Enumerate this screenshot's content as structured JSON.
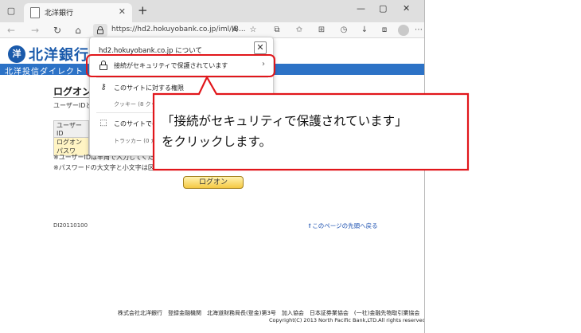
{
  "browser": {
    "tab_title": "北洋銀行",
    "url": "https://hd2.hokuyobank.co.jp/iml/IB...",
    "toolbar_icons": [
      "read-aloud-icon",
      "favorite-star-icon",
      "split-screen-icon",
      "favorites-icon",
      "collections-icon",
      "history-icon",
      "downloads-icon",
      "profile-icon",
      "more-icon"
    ]
  },
  "page": {
    "logo_text": "北洋銀行",
    "subbar_text": "北洋投信ダイレクト",
    "title": "ログオン",
    "intro": "ユーザーIDとロ",
    "form": {
      "user_id_label": "ユーザーID",
      "password_label": "ログオンパスワ"
    },
    "notes": [
      "※ユーザーIDは半角で入力してください。",
      "※パスワードの大文字と小文字は区別さ"
    ],
    "login_button": "ログオン",
    "page_id": "DI20110100",
    "top_link": "このページの先頭へ戻る",
    "footer_line1": "株式会社北洋銀行　登録金融機関　北海道財務局長(登金)第3号　加入協会　日本証券業協会　(一社)金融先物取引業協会",
    "footer_line2": "Copyright(C) 2013 North Pacific Bank,LTD.All rights reserved."
  },
  "flyout": {
    "host": "hd2.hokuyobank.co.jp について",
    "secure": "接続がセキュリティで保護されています",
    "permissions": "このサイトに対する権限",
    "cookies": "クッキー (8 クッキー",
    "tracking": "このサイトでの追跡",
    "trackers": "トラッカー (0 がブロ"
  },
  "callout": {
    "line1": "「接続がセキュリティで保護されています」",
    "line2": "をクリックします。"
  },
  "colors": {
    "annotation_red": "#e1161b",
    "brand_blue": "#1a5aab",
    "subbar_blue": "#2c72c6"
  }
}
